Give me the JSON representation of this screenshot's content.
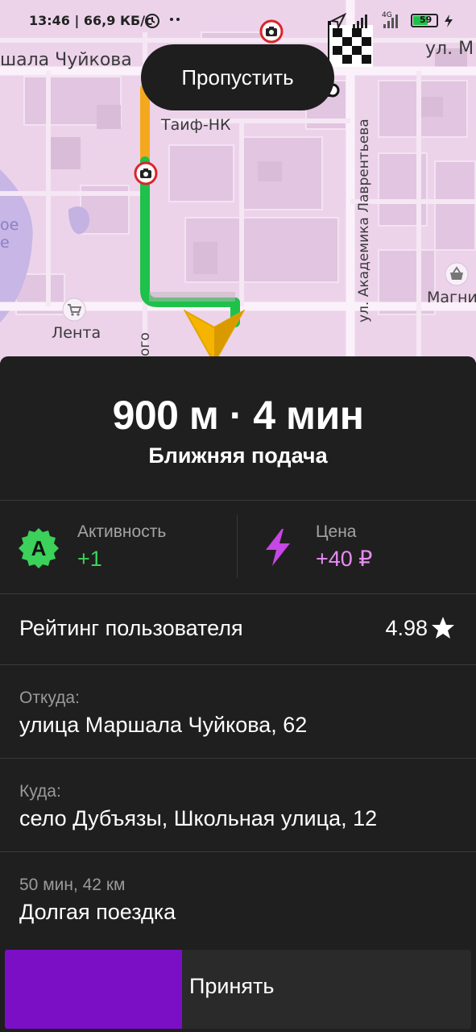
{
  "status_bar": {
    "time_speed": "13:46 | 66,9 КБ/с",
    "network": "4G",
    "battery": "59",
    "icons": [
      "alarm-icon",
      "location-arrow-icon",
      "signal-icon",
      "battery-icon",
      "charging-icon"
    ]
  },
  "map": {
    "labels": {
      "street_top_left": "шала Чуйкова",
      "street_top_right": "ул. М",
      "poi_taif": "Таиф-НК",
      "street_vertical": "ул. Академика Лаврентьева",
      "poi_magnit": "Магни",
      "poi_lenta": "Лента",
      "street_left_vertical": "ого",
      "water_1": "ое",
      "water_2": "е"
    },
    "skip_label": "Пропустить",
    "route_colors": {
      "slow": "#f4a81d",
      "free": "#1ec14a"
    }
  },
  "order": {
    "eta": "900 м · 4 мин",
    "subtitle": "Ближняя подача",
    "activity_label": "Активность",
    "activity_value": "+1",
    "price_label": "Цена",
    "price_value": "+40 ₽",
    "rating_label": "Рейтинг пользователя",
    "rating_value": "4.98",
    "from_label": "Откуда:",
    "from_value": "улица Маршала Чуйкова, 62",
    "to_label": "Куда:",
    "to_value": "село Дубъязы, Школьная улица, 12",
    "trip_meta": "50 мин, 42 км",
    "trip_type": "Долгая поездка",
    "accept_label": "Принять",
    "accept_progress": 0.38
  },
  "colors": {
    "accent_purple": "#7b0fc6",
    "activity_green": "#3bd15a",
    "price_pink": "#e88bf5"
  }
}
